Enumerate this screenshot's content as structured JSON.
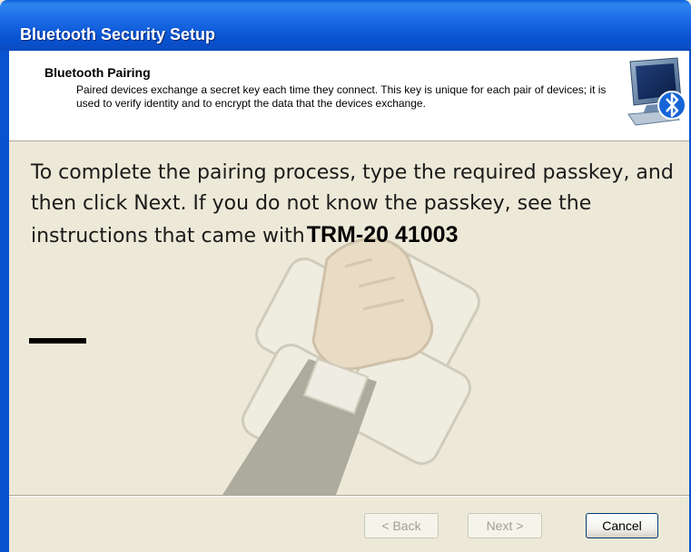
{
  "window": {
    "title": "Bluetooth Security Setup"
  },
  "header": {
    "title": "Bluetooth Pairing",
    "description": "Paired devices exchange a secret key each time they connect. This key is unique for each pair of devices; it is used to verify identity and to encrypt the data that the devices exchange.",
    "icon": "bluetooth-computer-icon"
  },
  "content": {
    "instruction": "To complete the pairing process, type the required passkey, and then click Next. If you do not know the passkey, see the instructions that came with",
    "device_name": "TRM-20 41003",
    "passkey_value": "",
    "watermark_icon": "hand-on-keypad-icon"
  },
  "buttons": {
    "back": "< Back",
    "next": "Next >",
    "cancel": "Cancel"
  },
  "colors": {
    "titlebar": "#0A53D0",
    "dialog_background": "#ECE9D8",
    "header_background": "#FFFFFF"
  }
}
